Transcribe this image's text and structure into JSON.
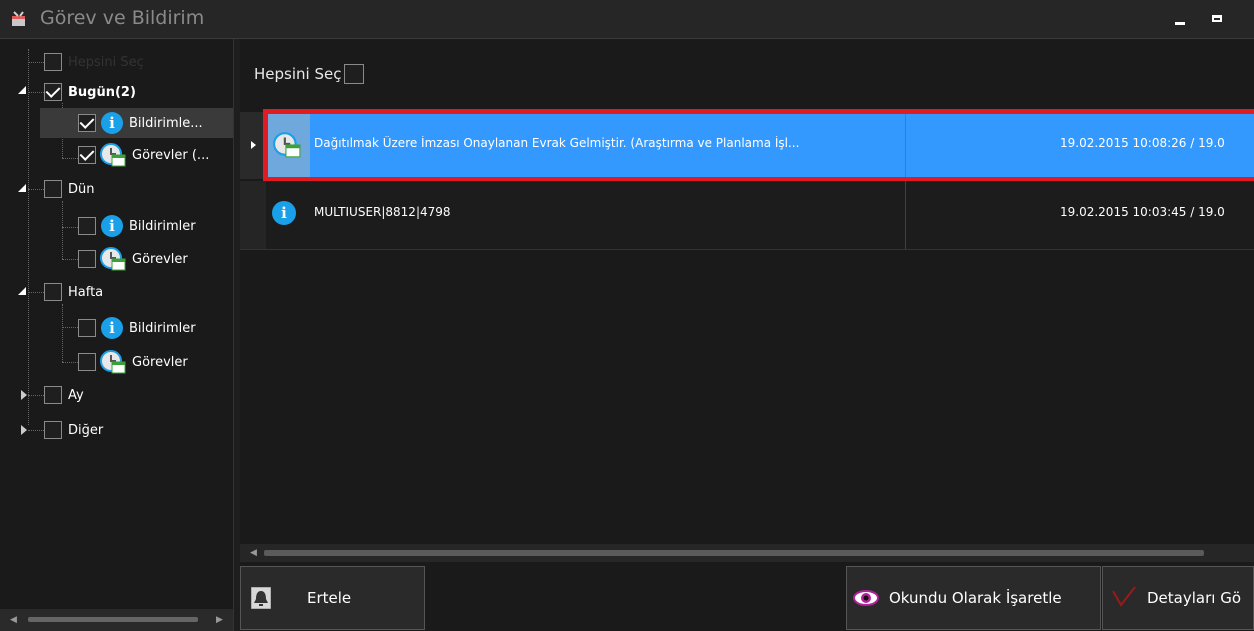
{
  "window": {
    "title": "Görev ve Bildirim"
  },
  "tree": {
    "select_all": "Hepsini Seç",
    "today": "Bugün(2)",
    "today_notifications": "Bildirimle...",
    "today_tasks": "Görevler (...",
    "yesterday": "Dün",
    "yesterday_notifications": "Bildirimler",
    "yesterday_tasks": "Görevler",
    "week": "Hafta",
    "week_notifications": "Bildirimler",
    "week_tasks": "Görevler",
    "month": "Ay",
    "other": "Diğer"
  },
  "main": {
    "select_all": "Hepsini Seç",
    "rows": [
      {
        "icon": "task-icon",
        "text": "Dağıtılmak Üzere İmzası Onaylanan Evrak Gelmiştir. (Araştırma ve Planlama İşl...",
        "date": "19.02.2015 10:08:26 / 19.0"
      },
      {
        "icon": "info-icon",
        "text": "MULTIUSER|8812|4798",
        "date": "19.02.2015 10:03:45 / 19.0"
      }
    ]
  },
  "buttons": {
    "postpone": "Ertele",
    "mark_read": "Okundu Olarak İşaretle",
    "details": "Detayları Gö"
  },
  "colors": {
    "selection": "#3399ff",
    "highlight_frame": "#e21b23",
    "info": "#1aa0e8"
  }
}
